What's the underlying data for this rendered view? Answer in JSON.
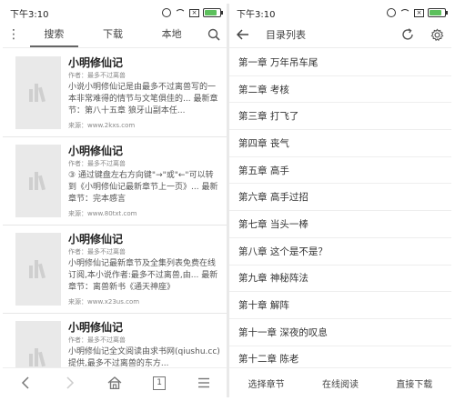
{
  "left": {
    "status": {
      "time": "下午3:10"
    },
    "tabs": [
      {
        "label": "搜索",
        "active": true
      },
      {
        "label": "下载",
        "active": false
      },
      {
        "label": "本地",
        "active": false
      }
    ],
    "results": [
      {
        "title": "小明修仙记",
        "author": "作者：最多不过离兽",
        "desc": "小说小明修仙记是由最多不过离兽写的一本非常难得的情节与文笔俱佳的... 最新章节：第八十五章 狼牙山副本任...",
        "source": "来源：www.2kxs.com"
      },
      {
        "title": "小明修仙记",
        "author": "作者：最多不过离兽",
        "desc": "③ 通过键盘左右方向键\"→\"或\"←\"可以转到《小明修仙记最新章节上一页》... 最新章节：完本感言",
        "source": "来源：www.80txt.com"
      },
      {
        "title": "小明修仙记",
        "author": "作者：最多不过离兽",
        "desc": "小明修仙记最新章节及全集列表免费在线订阅,本小说作者:最多不过离兽,由... 最新章节：离兽新书《通天神座》",
        "source": "来源：www.x23us.com"
      },
      {
        "title": "小明修仙记",
        "author": "作者：最多不过离兽",
        "desc": "小明修仙记全文阅读由求书网(qiushu.cc)提供,最多不过离兽的东方...",
        "source": ""
      }
    ],
    "nav": {
      "page": "1"
    }
  },
  "right": {
    "status": {
      "time": "下午3:10"
    },
    "title": "目录列表",
    "chapters": [
      "第一章 万年吊车尾",
      "第二章 考核",
      "第三章 打飞了",
      "第四章 丧气",
      "第五章 高手",
      "第六章 高手过招",
      "第七章 当头一棒",
      "第八章 这个是不是？",
      "第九章 神秘阵法",
      "第十章 解阵",
      "第十一章 深夜的叹息",
      "第十二章 陈老"
    ],
    "actions": {
      "select": "选择章节",
      "read": "在线阅读",
      "download": "直接下载"
    }
  },
  "colors": {
    "battery": "#5cc05c",
    "cover": "#e9e9e9"
  }
}
